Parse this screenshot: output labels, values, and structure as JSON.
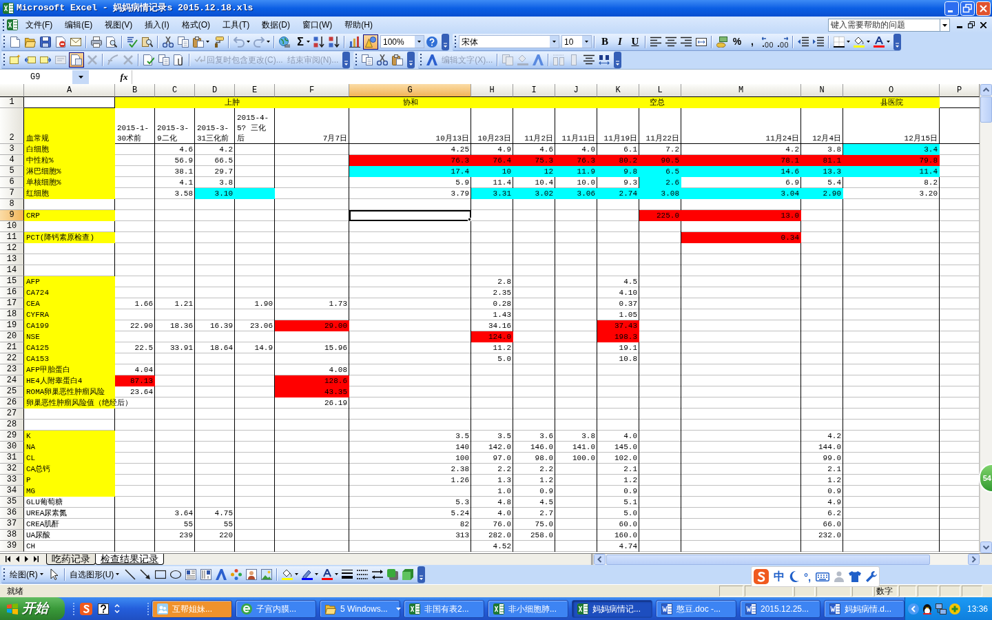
{
  "window": {
    "title": "Microsoft Excel - 妈妈病情记录s 2015.12.18.xls"
  },
  "menu": [
    "文件(F)",
    "编辑(E)",
    "视图(V)",
    "插入(I)",
    "格式(O)",
    "工具(T)",
    "数据(D)",
    "窗口(W)",
    "帮助(H)"
  ],
  "help_box": {
    "placeholder": "键入需要帮助的问题"
  },
  "standard_toolbar": {
    "autosum": "Σ",
    "zoom": "100%"
  },
  "formatting_toolbar": {
    "font": "宋体",
    "size": "10",
    "style_buttons": [
      "B",
      "I",
      "U"
    ],
    "number_buttons": [
      "%",
      ","
    ]
  },
  "reviewing_toolbar": {
    "buttons": [
      {
        "label": "回复时包含更改(C)...",
        "disabled": true
      },
      {
        "label": "结束审阅(N)...",
        "disabled": true
      }
    ]
  },
  "wordart_toolbar": {
    "buttons": [
      {
        "label": "编辑文字(X)...",
        "disabled": true
      }
    ]
  },
  "formula_bar": {
    "name_box": "G9",
    "function_button": "fx"
  },
  "sheet": {
    "columns": [
      {
        "label": "A",
        "selected": false
      },
      {
        "label": "B",
        "selected": false
      },
      {
        "label": "C",
        "selected": false
      },
      {
        "label": "D",
        "selected": false
      },
      {
        "label": "E",
        "selected": false
      },
      {
        "label": "F",
        "selected": false
      },
      {
        "label": "G",
        "selected": true
      },
      {
        "label": "H",
        "selected": false
      },
      {
        "label": "I",
        "selected": false
      },
      {
        "label": "J",
        "selected": false
      },
      {
        "label": "K",
        "selected": false
      },
      {
        "label": "L",
        "selected": false
      },
      {
        "label": "M",
        "selected": false
      },
      {
        "label": "N",
        "selected": false
      },
      {
        "label": "O",
        "selected": false
      },
      {
        "label": "P",
        "selected": false
      }
    ],
    "rows": [
      {
        "number": "1",
        "selected": false,
        "cells": [
          {},
          {
            "text": "上肿",
            "color": "#ffff00",
            "kind": "title"
          },
          {},
          {},
          {},
          {},
          {
            "text": "协和",
            "color": "#ffff00",
            "kind": "title"
          },
          {
            "text": "空总",
            "color": "#ffff00",
            "kind": "title"
          },
          {},
          {},
          {},
          {},
          {},
          {},
          {
            "text": "县医院",
            "color": "#ffff00",
            "kind": "title"
          }
        ]
      },
      {
        "number": "2",
        "selected": false,
        "cells": [
          {
            "text": "血常规",
            "color": "#ffff00",
            "kind": "text"
          },
          {
            "text": "2015-1-30术前",
            "kind": "text"
          },
          {
            "text": "2015-3-9二化",
            "kind": "text"
          },
          {
            "text": "2015-3-31三化前",
            "kind": "text"
          },
          {
            "text": "2015-4-5? 三化后",
            "kind": "text"
          },
          {
            "text": "7月7日"
          },
          {
            "text": "10月13日"
          },
          {
            "text": "10月23日"
          },
          {
            "text": "11月2日"
          },
          {
            "text": "11月11日"
          },
          {
            "text": "11月19日"
          },
          {
            "text": "11月22日"
          },
          {
            "text": "11月24日"
          },
          {
            "text": "12月4日"
          },
          {
            "text": "12月15日"
          }
        ]
      },
      {
        "number": "3",
        "selected": false,
        "cells": [
          {
            "text": "白细胞",
            "color": "#ffff00",
            "kind": "text"
          },
          {},
          {
            "text": "4.6"
          },
          {
            "text": "4.2"
          },
          {},
          {},
          {
            "text": "4.25"
          },
          {
            "text": "4.9"
          },
          {
            "text": "4.6"
          },
          {
            "text": "4.0"
          },
          {
            "text": "6.1"
          },
          {
            "text": "7.2"
          },
          {
            "text": "4.2"
          },
          {
            "text": "3.8"
          },
          {
            "text": "3.4",
            "color": "#00ffff"
          }
        ]
      },
      {
        "number": "4",
        "selected": false,
        "cells": [
          {
            "text": "中性粒%",
            "color": "#ffff00",
            "kind": "text"
          },
          {},
          {
            "text": "56.9"
          },
          {
            "text": "66.5"
          },
          {},
          {},
          {
            "text": "76.3",
            "color": "#ff0000"
          },
          {
            "text": "76.4",
            "color": "#ff0000"
          },
          {
            "text": "75.3",
            "color": "#ff0000"
          },
          {
            "text": "76.3",
            "color": "#ff0000"
          },
          {
            "text": "80.2",
            "color": "#ff0000"
          },
          {
            "text": "90.5",
            "color": "#ff0000"
          },
          {
            "text": "78.1",
            "color": "#ff0000"
          },
          {
            "text": "81.1",
            "color": "#ff0000"
          },
          {
            "text": "79.8",
            "color": "#ff0000"
          }
        ]
      },
      {
        "number": "5",
        "selected": false,
        "cells": [
          {
            "text": "淋巴细胞%",
            "color": "#ffff00",
            "kind": "text"
          },
          {},
          {
            "text": "38.1"
          },
          {
            "text": "29.7"
          },
          {},
          {},
          {
            "text": "17.4",
            "color": "#00ffff"
          },
          {
            "text": "10",
            "color": "#00ffff"
          },
          {
            "text": "12",
            "color": "#00ffff"
          },
          {
            "text": "11.9",
            "color": "#00ffff"
          },
          {
            "text": "9.8",
            "color": "#00ffff"
          },
          {
            "text": "6.5",
            "color": "#00ffff"
          },
          {
            "text": "14.6",
            "color": "#00ffff"
          },
          {
            "text": "13.3",
            "color": "#00ffff"
          },
          {
            "text": "11.4",
            "color": "#00ffff"
          }
        ]
      },
      {
        "number": "6",
        "selected": false,
        "cells": [
          {
            "text": "单核细胞%",
            "color": "#ffff00",
            "kind": "text"
          },
          {},
          {
            "text": "4.1"
          },
          {
            "text": "3.8"
          },
          {},
          {},
          {
            "text": "5.9"
          },
          {
            "text": "11.4"
          },
          {
            "text": "10.4"
          },
          {
            "text": "10.0"
          },
          {
            "text": "9.3"
          },
          {
            "text": "2.6",
            "color": "#00ffff"
          },
          {
            "text": "6.9"
          },
          {
            "text": "5.4"
          },
          {
            "text": "8.2"
          }
        ]
      },
      {
        "number": "7",
        "selected": false,
        "cells": [
          {
            "text": "红细胞",
            "color": "#ffff00",
            "kind": "text"
          },
          {},
          {
            "text": "3.58"
          },
          {
            "text": "3.10",
            "color": "#00ffff"
          },
          {
            "color": "#00ffff"
          },
          {},
          {
            "text": "3.79"
          },
          {
            "text": "3.31",
            "color": "#00ffff"
          },
          {
            "text": "3.02",
            "color": "#00ffff"
          },
          {
            "text": "3.06",
            "color": "#00ffff"
          },
          {
            "text": "2.74",
            "color": "#00ffff"
          },
          {
            "text": "3.08",
            "color": "#00ffff"
          },
          {
            "text": "3.04",
            "color": "#00ffff"
          },
          {
            "text": "2.90",
            "color": "#00ffff"
          },
          {
            "text": "3.20"
          }
        ]
      },
      {
        "number": "8",
        "selected": false
      },
      {
        "number": "9",
        "selected": true,
        "cells": [
          {
            "text": "CRP",
            "color": "#ffff00",
            "kind": "text"
          },
          {},
          {},
          {},
          {},
          {},
          {
            "active": true
          },
          {},
          {},
          {},
          {},
          {
            "text": "225.0",
            "color": "#ff0000"
          },
          {
            "text": "13.0",
            "color": "#ff0000"
          }
        ]
      },
      {
        "number": "10",
        "selected": false
      },
      {
        "number": "11",
        "selected": false,
        "cells": [
          {
            "text": "PCT(降钙素原检查)",
            "color": "#ffff00",
            "kind": "text"
          },
          {},
          {},
          {},
          {},
          {},
          {},
          {},
          {},
          {},
          {},
          {},
          {
            "text": "0.34",
            "color": "#ff0000"
          }
        ]
      },
      {
        "number": "12",
        "selected": false
      },
      {
        "number": "13",
        "selected": false
      },
      {
        "number": "14",
        "selected": false
      },
      {
        "number": "15",
        "selected": false,
        "cells": [
          {
            "text": "AFP",
            "color": "#ffff00",
            "kind": "text"
          },
          {},
          {},
          {},
          {},
          {},
          {},
          {
            "text": "2.8"
          },
          {},
          {},
          {
            "text": "4.5"
          }
        ]
      },
      {
        "number": "16",
        "selected": false,
        "cells": [
          {
            "text": "CA724",
            "color": "#ffff00",
            "kind": "text"
          },
          {},
          {},
          {},
          {},
          {},
          {},
          {
            "text": "2.35"
          },
          {},
          {},
          {
            "text": "4.10"
          }
        ]
      },
      {
        "number": "17",
        "selected": false,
        "cells": [
          {
            "text": "CEA",
            "color": "#ffff00",
            "kind": "text"
          },
          {
            "text": "1.66"
          },
          {
            "text": "1.21"
          },
          {},
          {
            "text": "1.90"
          },
          {
            "text": "1.73"
          },
          {},
          {
            "text": "0.28"
          },
          {},
          {},
          {
            "text": "0.37"
          }
        ]
      },
      {
        "number": "18",
        "selected": false,
        "cells": [
          {
            "text": "CYFRA",
            "color": "#ffff00",
            "kind": "text"
          },
          {},
          {},
          {},
          {},
          {},
          {},
          {
            "text": "1.43"
          },
          {},
          {},
          {
            "text": "1.05"
          }
        ]
      },
      {
        "number": "19",
        "selected": false,
        "cells": [
          {
            "text": "CA199",
            "color": "#ffff00",
            "kind": "text"
          },
          {
            "text": "22.90"
          },
          {
            "text": "18.36"
          },
          {
            "text": "16.39"
          },
          {
            "text": "23.06"
          },
          {
            "text": "29.00",
            "color": "#ff0000"
          },
          {},
          {
            "text": "34.16"
          },
          {},
          {},
          {
            "text": "37.43",
            "color": "#ff0000"
          }
        ]
      },
      {
        "number": "20",
        "selected": false,
        "cells": [
          {
            "text": "NSE",
            "color": "#ffff00",
            "kind": "text"
          },
          {},
          {},
          {},
          {},
          {},
          {},
          {
            "text": "124.0",
            "color": "#ff0000"
          },
          {},
          {},
          {
            "text": "198.3",
            "color": "#ff0000"
          }
        ]
      },
      {
        "number": "21",
        "selected": false,
        "cells": [
          {
            "text": "CA125",
            "color": "#ffff00",
            "kind": "text"
          },
          {
            "text": "22.5"
          },
          {
            "text": "33.91"
          },
          {
            "text": "18.64"
          },
          {
            "text": "14.9"
          },
          {
            "text": "15.96"
          },
          {},
          {
            "text": "11.2"
          },
          {},
          {},
          {
            "text": "19.1"
          }
        ]
      },
      {
        "number": "22",
        "selected": false,
        "cells": [
          {
            "text": "CA153",
            "color": "#ffff00",
            "kind": "text"
          },
          {},
          {},
          {},
          {},
          {},
          {},
          {
            "text": "5.0"
          },
          {},
          {},
          {
            "text": "10.8"
          }
        ]
      },
      {
        "number": "23",
        "selected": false,
        "cells": [
          {
            "text": "AFP甲胎蛋白",
            "color": "#ffff00",
            "kind": "text"
          },
          {
            "text": "4.04"
          },
          {},
          {},
          {},
          {
            "text": "4.08"
          }
        ]
      },
      {
        "number": "24",
        "selected": false,
        "cells": [
          {
            "text": "HE4人附睾蛋白4",
            "color": "#ffff00",
            "kind": "text"
          },
          {
            "text": "87.13",
            "color": "#ff0000"
          },
          {},
          {},
          {},
          {
            "text": "128.6",
            "color": "#ff0000"
          }
        ]
      },
      {
        "number": "25",
        "selected": false,
        "cells": [
          {
            "text": "ROMA卵巢恶性肿瘤风险",
            "color": "#ffff00",
            "kind": "text"
          },
          {
            "text": "23.64"
          },
          {},
          {},
          {},
          {
            "text": "43.35",
            "color": "#ff0000"
          }
        ]
      },
      {
        "number": "26",
        "selected": false,
        "cells": [
          {
            "text": "卵巢恶性肿瘤风险值（绝经后）",
            "color": "#ffff00",
            "kind": "text"
          },
          {},
          {},
          {},
          {},
          {
            "text": "26.19"
          }
        ]
      },
      {
        "number": "27",
        "selected": false
      },
      {
        "number": "28",
        "selected": false
      },
      {
        "number": "29",
        "selected": false,
        "cells": [
          {
            "text": "K",
            "color": "#ffff00",
            "kind": "text"
          },
          {},
          {},
          {},
          {},
          {},
          {
            "text": "3.5"
          },
          {
            "text": "3.5"
          },
          {
            "text": "3.6"
          },
          {
            "text": "3.8"
          },
          {
            "text": "4.0"
          },
          {},
          {},
          {
            "text": "4.2"
          }
        ]
      },
      {
        "number": "30",
        "selected": false,
        "cells": [
          {
            "text": "NA",
            "color": "#ffff00",
            "kind": "text"
          },
          {},
          {},
          {},
          {},
          {},
          {
            "text": "140"
          },
          {
            "text": "142.0"
          },
          {
            "text": "146.0"
          },
          {
            "text": "141.0"
          },
          {
            "text": "145.0"
          },
          {},
          {},
          {
            "text": "144.0"
          }
        ]
      },
      {
        "number": "31",
        "selected": false,
        "cells": [
          {
            "text": "CL",
            "color": "#ffff00",
            "kind": "text"
          },
          {},
          {},
          {},
          {},
          {},
          {
            "text": "100"
          },
          {
            "text": "97.0"
          },
          {
            "text": "98.0"
          },
          {
            "text": "100.0"
          },
          {
            "text": "102.0"
          },
          {},
          {},
          {
            "text": "99.0"
          }
        ]
      },
      {
        "number": "32",
        "selected": false,
        "cells": [
          {
            "text": "CA总钙",
            "color": "#ffff00",
            "kind": "text"
          },
          {},
          {},
          {},
          {},
          {},
          {
            "text": "2.38"
          },
          {
            "text": "2.2"
          },
          {
            "text": "2.2"
          },
          {},
          {
            "text": "2.1"
          },
          {},
          {},
          {
            "text": "2.1"
          }
        ]
      },
      {
        "number": "33",
        "selected": false,
        "cells": [
          {
            "text": "P",
            "color": "#ffff00",
            "kind": "text"
          },
          {},
          {},
          {},
          {},
          {},
          {
            "text": "1.26"
          },
          {
            "text": "1.3"
          },
          {
            "text": "1.2"
          },
          {},
          {
            "text": "1.2"
          },
          {},
          {},
          {
            "text": "1.2"
          }
        ]
      },
      {
        "number": "34",
        "selected": false,
        "cells": [
          {
            "text": "MG",
            "color": "#ffff00",
            "kind": "text"
          },
          {},
          {},
          {},
          {},
          {},
          {},
          {
            "text": "1.0"
          },
          {
            "text": "0.9"
          },
          {},
          {
            "text": "0.9"
          },
          {},
          {},
          {
            "text": "0.9"
          }
        ]
      },
      {
        "number": "35",
        "selected": false,
        "cells": [
          {
            "text": "GLU葡萄糖",
            "kind": "text"
          },
          {},
          {},
          {},
          {},
          {},
          {
            "text": "5.3"
          },
          {
            "text": "4.8"
          },
          {
            "text": "4.5"
          },
          {},
          {
            "text": "5.1"
          },
          {},
          {},
          {
            "text": "4.9"
          }
        ]
      },
      {
        "number": "36",
        "selected": false,
        "cells": [
          {
            "text": "UREA尿素氮",
            "kind": "text"
          },
          {},
          {
            "text": "3.64"
          },
          {
            "text": "4.75"
          },
          {},
          {},
          {
            "text": "5.24"
          },
          {
            "text": "4.0"
          },
          {
            "text": "2.7"
          },
          {},
          {
            "text": "5.0"
          },
          {},
          {},
          {
            "text": "6.2"
          }
        ]
      },
      {
        "number": "37",
        "selected": false,
        "cells": [
          {
            "text": "CREA肌酐",
            "kind": "text"
          },
          {},
          {
            "text": "55"
          },
          {
            "text": "55"
          },
          {},
          {},
          {
            "text": "82"
          },
          {
            "text": "76.0"
          },
          {
            "text": "75.0"
          },
          {},
          {
            "text": "60.0"
          },
          {},
          {},
          {
            "text": "66.0"
          }
        ]
      },
      {
        "number": "38",
        "selected": false,
        "cells": [
          {
            "text": "UA尿酸",
            "kind": "text"
          },
          {},
          {
            "text": "239"
          },
          {
            "text": "220"
          },
          {},
          {},
          {
            "text": "313"
          },
          {
            "text": "282.0"
          },
          {
            "text": "258.0"
          },
          {},
          {
            "text": "160.0"
          },
          {},
          {},
          {
            "text": "232.0"
          }
        ]
      },
      {
        "number": "39",
        "selected": false,
        "cells": [
          {
            "text": "CH",
            "kind": "text"
          },
          {},
          {},
          {},
          {},
          {},
          {},
          {
            "text": "4.52"
          },
          {},
          {},
          {
            "text": "4.74"
          }
        ]
      }
    ]
  },
  "sheet_tabs": [
    {
      "label": "吃药记录",
      "selected": false
    },
    {
      "label": "检查结果记录",
      "selected": true
    }
  ],
  "drawing_toolbar": {
    "menus": [
      "绘图(R)",
      "自选图形(U)"
    ]
  },
  "ime_bar": {
    "mode": "中",
    "punctuation": "°,"
  },
  "status_bar": {
    "status": "就绪",
    "indicator": "数字"
  },
  "side_widget": {
    "label": "54"
  },
  "taskbar": {
    "start": "开始",
    "windows": [
      {
        "label": "互帮姐妹...",
        "kind": "chat",
        "selected": false,
        "flashing": true,
        "grouped": false
      },
      {
        "label": "子宫内膜...",
        "kind": "browser",
        "selected": false,
        "flashing": false,
        "grouped": false
      },
      {
        "label": "5 Windows...",
        "kind": "folder",
        "selected": false,
        "flashing": false,
        "grouped": true
      },
      {
        "label": "非国有表2...",
        "kind": "spreadsheet",
        "selected": false,
        "flashing": false,
        "grouped": false
      },
      {
        "label": "非小细胞肺...",
        "kind": "spreadsheet",
        "selected": false,
        "flashing": false,
        "grouped": false
      },
      {
        "label": "妈妈病情记...",
        "kind": "spreadsheet",
        "selected": true,
        "flashing": false,
        "grouped": false
      },
      {
        "label": "憨豆.doc -...",
        "kind": "document",
        "selected": false,
        "flashing": false,
        "grouped": false
      },
      {
        "label": "2015.12.25...",
        "kind": "document",
        "selected": false,
        "flashing": false,
        "grouped": false
      },
      {
        "label": "妈妈病情.d...",
        "kind": "document",
        "selected": false,
        "flashing": false,
        "grouped": false
      }
    ],
    "clock": "13:36"
  }
}
